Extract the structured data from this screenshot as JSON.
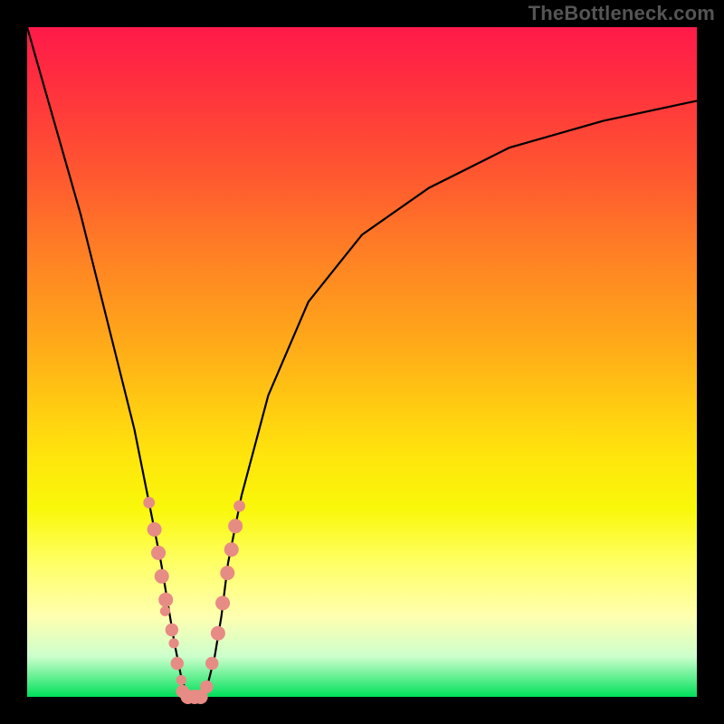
{
  "watermark": "TheBottleneck.com",
  "colors": {
    "frame_bg": "#000000",
    "curve_stroke": "#000000",
    "dot_fill": "#e78b85",
    "dot_stroke": "#c06a64"
  },
  "chart_data": {
    "type": "line",
    "title": "",
    "xlabel": "",
    "ylabel": "",
    "xlim": [
      0,
      100
    ],
    "ylim": [
      0,
      100
    ],
    "grid": false,
    "legend": false,
    "x": [
      0,
      4,
      8,
      12,
      16,
      18,
      20,
      21,
      22,
      23,
      24,
      25,
      26,
      27,
      28,
      29,
      30,
      32,
      36,
      42,
      50,
      60,
      72,
      86,
      100
    ],
    "values": [
      100,
      86,
      72,
      56,
      40,
      30,
      20,
      14,
      8,
      3,
      0,
      0,
      0,
      2,
      6,
      12,
      20,
      30,
      45,
      59,
      69,
      76,
      82,
      86,
      89
    ],
    "series": [
      {
        "name": "bottleneck-curve",
        "x": [
          0,
          4,
          8,
          12,
          16,
          18,
          20,
          21,
          22,
          23,
          24,
          25,
          26,
          27,
          28,
          29,
          30,
          32,
          36,
          42,
          50,
          60,
          72,
          86,
          100
        ],
        "y": [
          100,
          86,
          72,
          56,
          40,
          30,
          20,
          14,
          8,
          3,
          0,
          0,
          0,
          2,
          6,
          12,
          20,
          30,
          45,
          59,
          69,
          76,
          82,
          86,
          89
        ]
      }
    ],
    "markers": [
      {
        "x": 18.2,
        "y": 29.0,
        "r": 0.8
      },
      {
        "x": 19.0,
        "y": 25.0,
        "r": 1.0
      },
      {
        "x": 19.6,
        "y": 21.5,
        "r": 1.0
      },
      {
        "x": 20.1,
        "y": 18.0,
        "r": 1.0
      },
      {
        "x": 20.7,
        "y": 14.5,
        "r": 1.0
      },
      {
        "x": 20.6,
        "y": 12.8,
        "r": 0.7
      },
      {
        "x": 21.6,
        "y": 10.0,
        "r": 0.9
      },
      {
        "x": 21.9,
        "y": 8.0,
        "r": 0.7
      },
      {
        "x": 22.4,
        "y": 5.0,
        "r": 0.9
      },
      {
        "x": 23.0,
        "y": 2.5,
        "r": 0.7
      },
      {
        "x": 23.2,
        "y": 0.8,
        "r": 0.9
      },
      {
        "x": 24.0,
        "y": 0.0,
        "r": 1.0
      },
      {
        "x": 25.0,
        "y": 0.0,
        "r": 1.0
      },
      {
        "x": 25.9,
        "y": 0.0,
        "r": 1.0
      },
      {
        "x": 26.8,
        "y": 1.5,
        "r": 0.9
      },
      {
        "x": 27.6,
        "y": 5.0,
        "r": 0.9
      },
      {
        "x": 28.5,
        "y": 9.5,
        "r": 1.0
      },
      {
        "x": 29.2,
        "y": 14.0,
        "r": 1.0
      },
      {
        "x": 29.9,
        "y": 18.5,
        "r": 1.0
      },
      {
        "x": 30.5,
        "y": 22.0,
        "r": 1.0
      },
      {
        "x": 31.1,
        "y": 25.5,
        "r": 1.0
      },
      {
        "x": 31.7,
        "y": 28.5,
        "r": 0.8
      }
    ]
  }
}
